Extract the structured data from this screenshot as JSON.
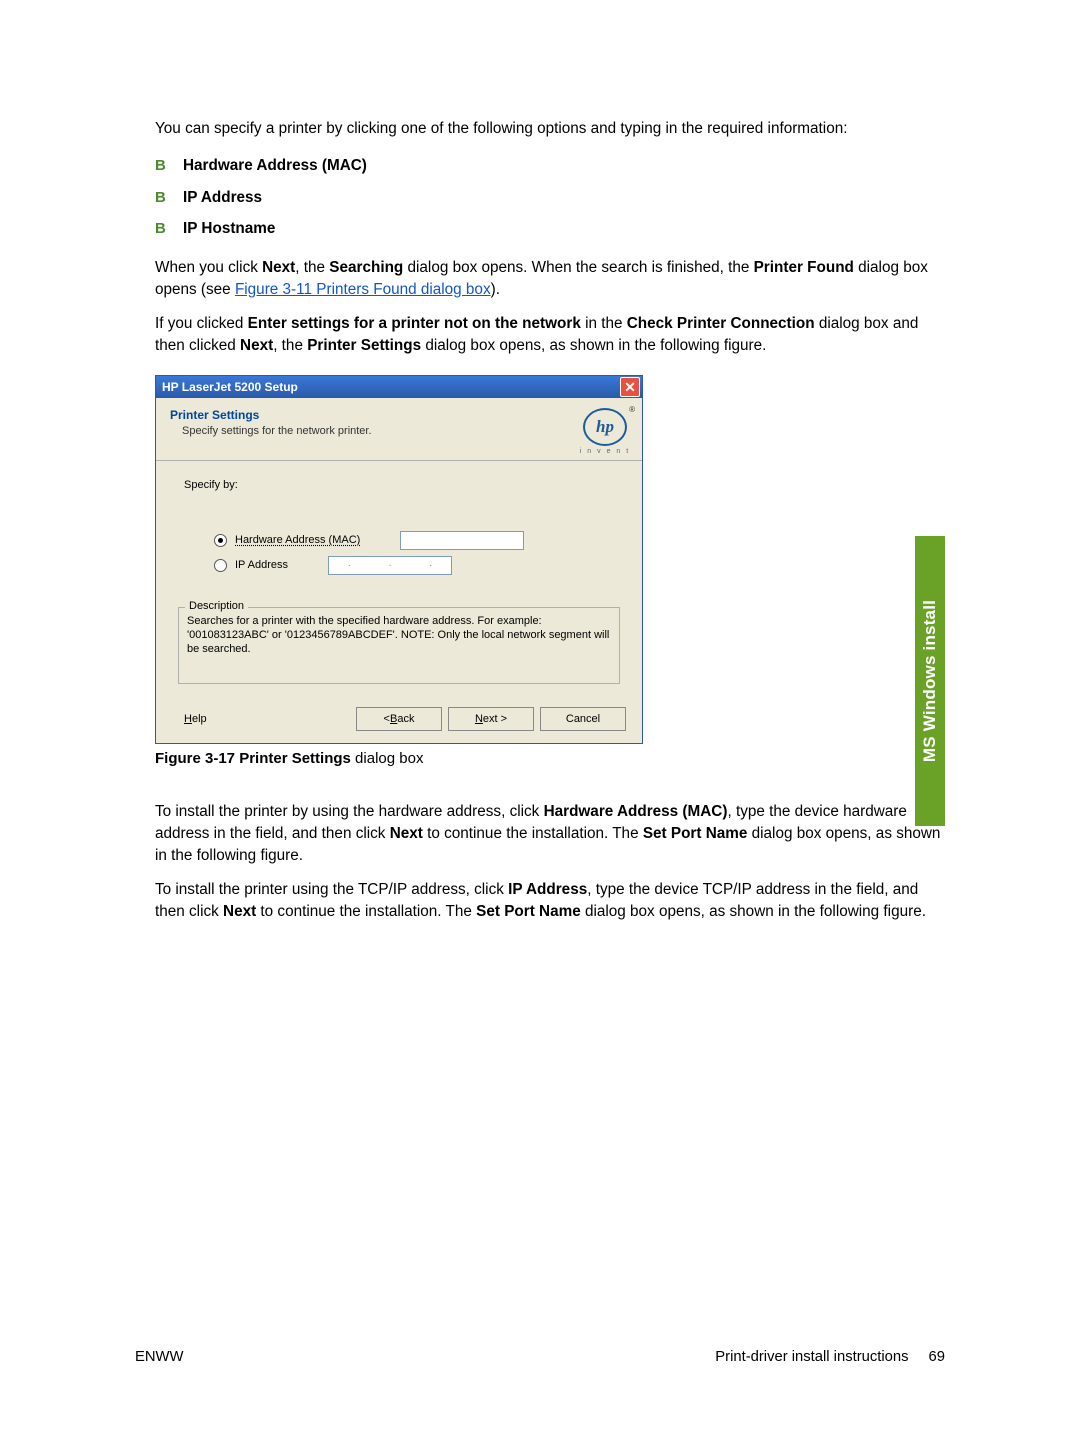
{
  "intro": "You can specify a printer by clicking one of the following options and typing in the required information:",
  "bullets": [
    "Hardware Address (MAC)",
    "IP Address",
    "IP Hostname"
  ],
  "para2_a": "When you click ",
  "para2_next": "Next",
  "para2_b": ", the ",
  "para2_search": "Searching",
  "para2_c": " dialog box opens. When the search is finished, the ",
  "para2_found": "Printer Found",
  "para2_d": " dialog box opens (see ",
  "xref": "Figure 3-11 Printers Found dialog box",
  "para2_e": ").",
  "para3_a": "If you clicked ",
  "para3_b1": "Enter settings for a printer not on the network",
  "para3_c": " in the ",
  "para3_b2": "Check Printer Connection",
  "para3_d": " dialog box and then clicked ",
  "para3_b3": "Next",
  "para3_e": ", the ",
  "para3_b4": "Printer Settings",
  "para3_f": " dialog box opens, as shown in the following figure.",
  "dialog": {
    "title": "HP LaserJet 5200 Setup",
    "head_title": "Printer Settings",
    "head_sub": "Specify settings for the network printer.",
    "logo_txt": "hp",
    "logo_sub": "i n v e n t",
    "reg": "®",
    "specify": "Specify by:",
    "radio_mac": "Hardware Address (MAC)",
    "radio_ip": "IP Address",
    "ip_dots": "·   ·   ·",
    "fieldset_legend": "Description",
    "desc": "Searches for a printer with the specified hardware address.  For example: '001083123ABC' or '0123456789ABCDEF'.  NOTE: Only the local network segment will be searched.",
    "help_u": "H",
    "help_r": "elp",
    "back_l": "< ",
    "back_u": "B",
    "back_r": "ack",
    "next_u": "N",
    "next_r": "ext >",
    "cancel": "Cancel"
  },
  "figcap_b": "Figure 3-17",
  "figcap_m": "  Printer Settings",
  "figcap_r": " dialog box",
  "para4_a": "To install the printer by using the hardware address, click ",
  "para4_b1": "Hardware Address (MAC)",
  "para4_c": ", type the device hardware address in the field, and then click ",
  "para4_b2": "Next",
  "para4_d": " to continue the installation. The ",
  "para4_b3": "Set Port Name",
  "para4_e": " dialog box opens, as shown in the following figure.",
  "para5_a": "To install the printer using the TCP/IP address, click ",
  "para5_b1": "IP Address",
  "para5_c": ", type the device TCP/IP address in the field, and then click ",
  "para5_b2": "Next",
  "para5_d": " to continue the installation. The ",
  "para5_b3": "Set Port Name",
  "para5_e": " dialog box opens, as shown in the following figure.",
  "side_tab": "MS Windows install",
  "footer_left": "ENWW",
  "footer_right": "Print-driver install instructions",
  "page_num": "69"
}
